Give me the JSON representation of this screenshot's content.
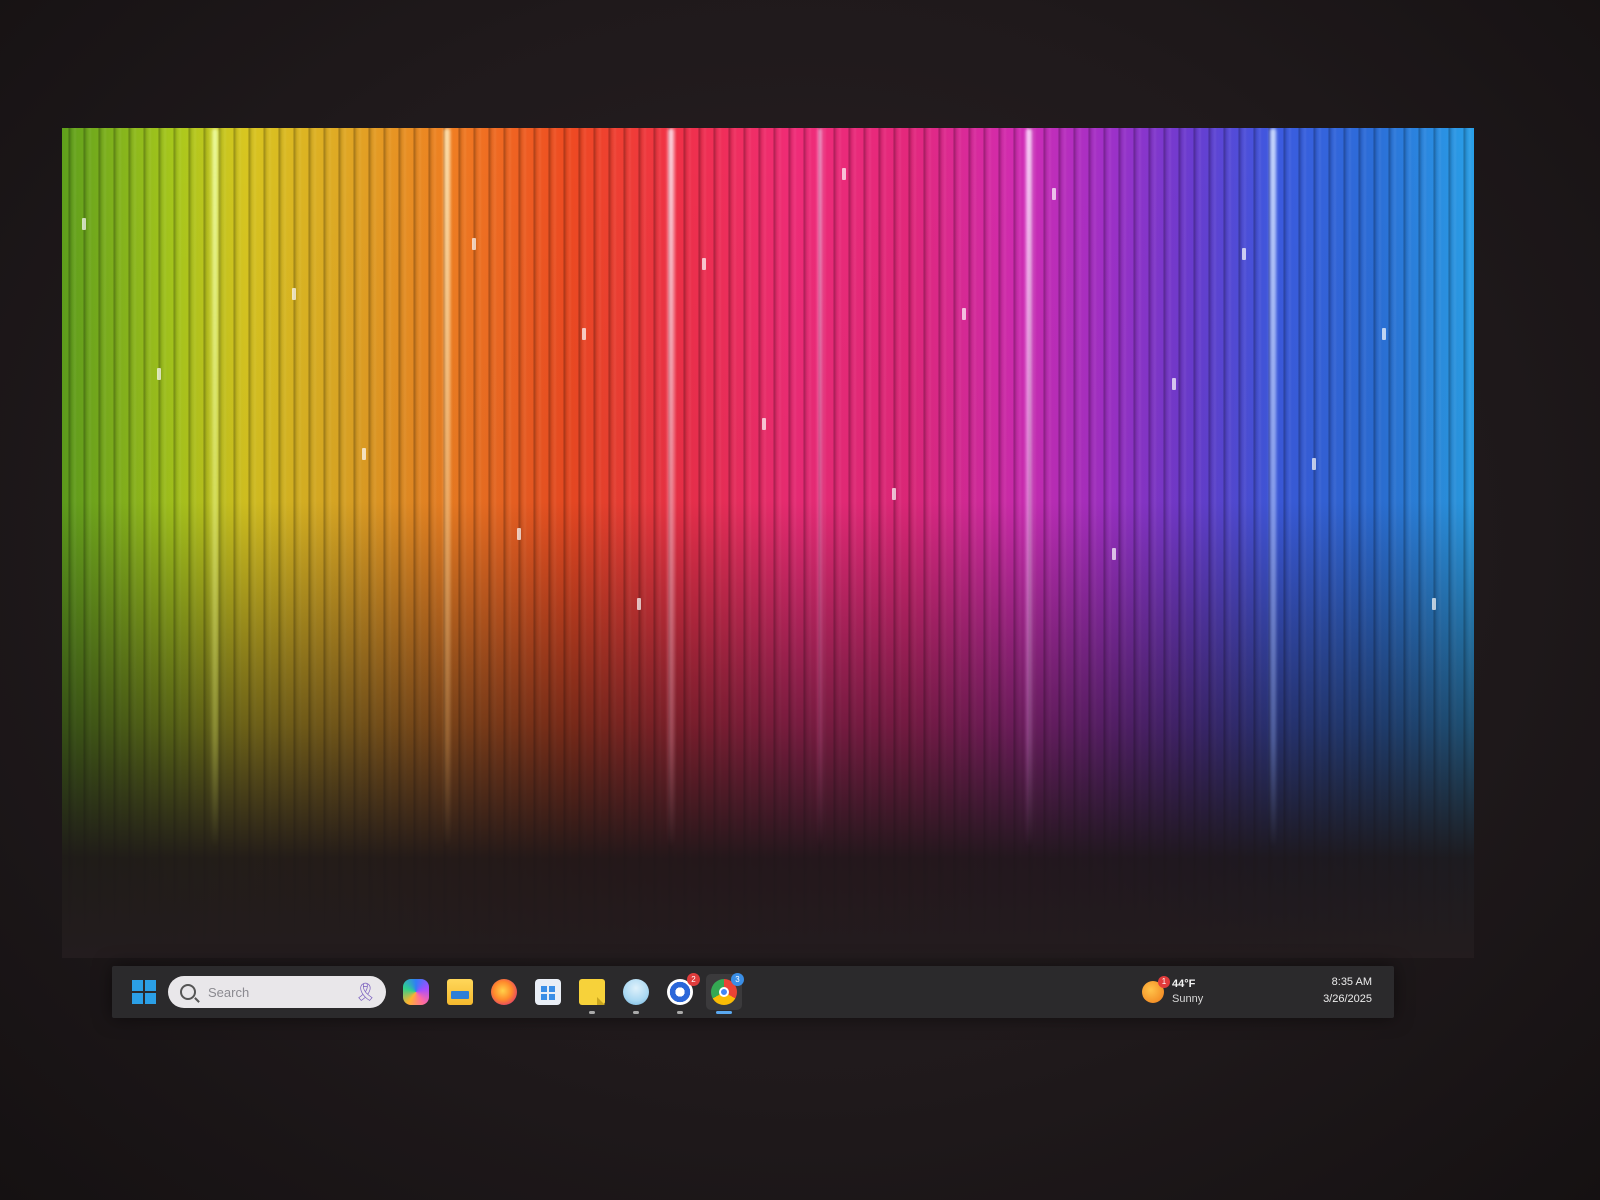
{
  "taskbar": {
    "search": {
      "placeholder": "Search"
    },
    "apps": [
      {
        "name": "copilot-icon",
        "color": "#8a5cf6"
      },
      {
        "name": "file-explorer-icon",
        "color": "#f5c542"
      },
      {
        "name": "firefox-icon",
        "color": "#ff7139"
      },
      {
        "name": "store-icon",
        "color": "#3a8ee6"
      },
      {
        "name": "sticky-notes-icon",
        "color": "#f7d23a"
      },
      {
        "name": "chatbot-icon",
        "color": "#a9d8f2"
      },
      {
        "name": "media-app-icon",
        "color": "#e03c3c",
        "badge": "2"
      },
      {
        "name": "chrome-icon",
        "color": "#34a853",
        "badge": "3"
      }
    ]
  },
  "weather": {
    "temperature": "44°F",
    "condition": "Sunny",
    "badge": "1"
  },
  "clock": {
    "time": "8:35 AM",
    "date": "3/26/2025"
  },
  "colors": {
    "taskbar": "#2b2a2c",
    "accent": "#2b9fe6"
  }
}
